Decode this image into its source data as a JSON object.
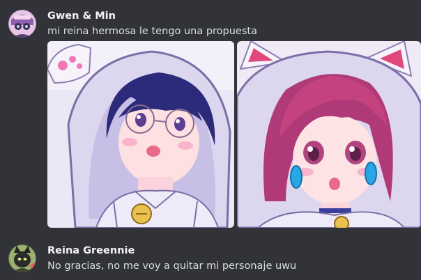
{
  "messages": [
    {
      "author": "Gwen & Min",
      "text": "mi reina hermosa le tengo una propuesta",
      "attachments": [
        {
          "icon": "anime-boy-cat-hoodie-image"
        },
        {
          "icon": "anime-girl-cat-hoodie-image"
        }
      ]
    },
    {
      "author": "Reina Greennie",
      "text": "No gracias, no me voy a quitar mi personaje uwu"
    }
  ],
  "colors": {
    "background": "#313338",
    "author_name": "#f2f3f5",
    "message_text": "#dbdee1"
  }
}
